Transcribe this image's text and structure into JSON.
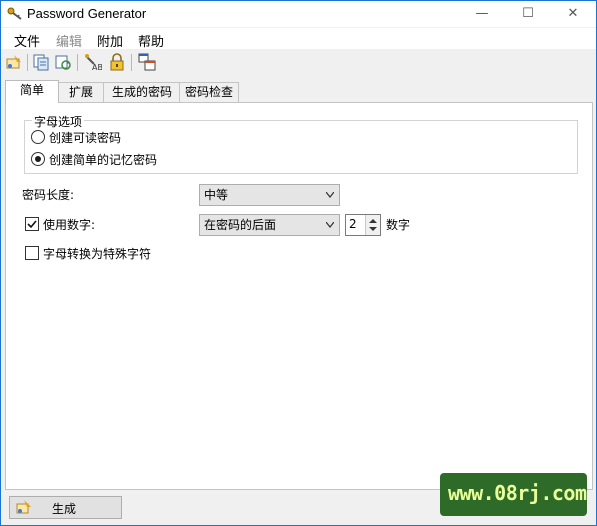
{
  "window": {
    "title": "Password Generator"
  },
  "window_controls": {
    "minimize": "—",
    "maximize": "☐",
    "close": "✕"
  },
  "menu": {
    "items": [
      {
        "label": "文件",
        "enabled": true
      },
      {
        "label": "编辑",
        "enabled": false
      },
      {
        "label": "附加",
        "enabled": true
      },
      {
        "label": "帮助",
        "enabled": true
      }
    ]
  },
  "toolbar": {
    "icons": [
      "generate-icon",
      "copy-list-icon",
      "refresh-list-icon",
      "password-test-icon",
      "lock-icon",
      "windows-icon"
    ]
  },
  "tabs": [
    {
      "label": "简单",
      "active": true
    },
    {
      "label": "扩展",
      "active": false
    },
    {
      "label": "生成的密码",
      "active": false
    },
    {
      "label": "密码检查",
      "active": false
    }
  ],
  "letter_options": {
    "title": "字母选项",
    "options": [
      {
        "label": "创建可读密码",
        "checked": false
      },
      {
        "label": "创建简单的记忆密码",
        "checked": true
      }
    ]
  },
  "password_length": {
    "label": "密码长度:",
    "value": "中等"
  },
  "use_digits": {
    "label": "使用数字:",
    "checked": true,
    "position": "在密码的后面",
    "count": "2",
    "unit": "数字"
  },
  "special_chars": {
    "label": "字母转换为特殊字符",
    "checked": false
  },
  "generate_button": {
    "label": "生成"
  },
  "watermark": {
    "text": "www.08rj.com"
  }
}
